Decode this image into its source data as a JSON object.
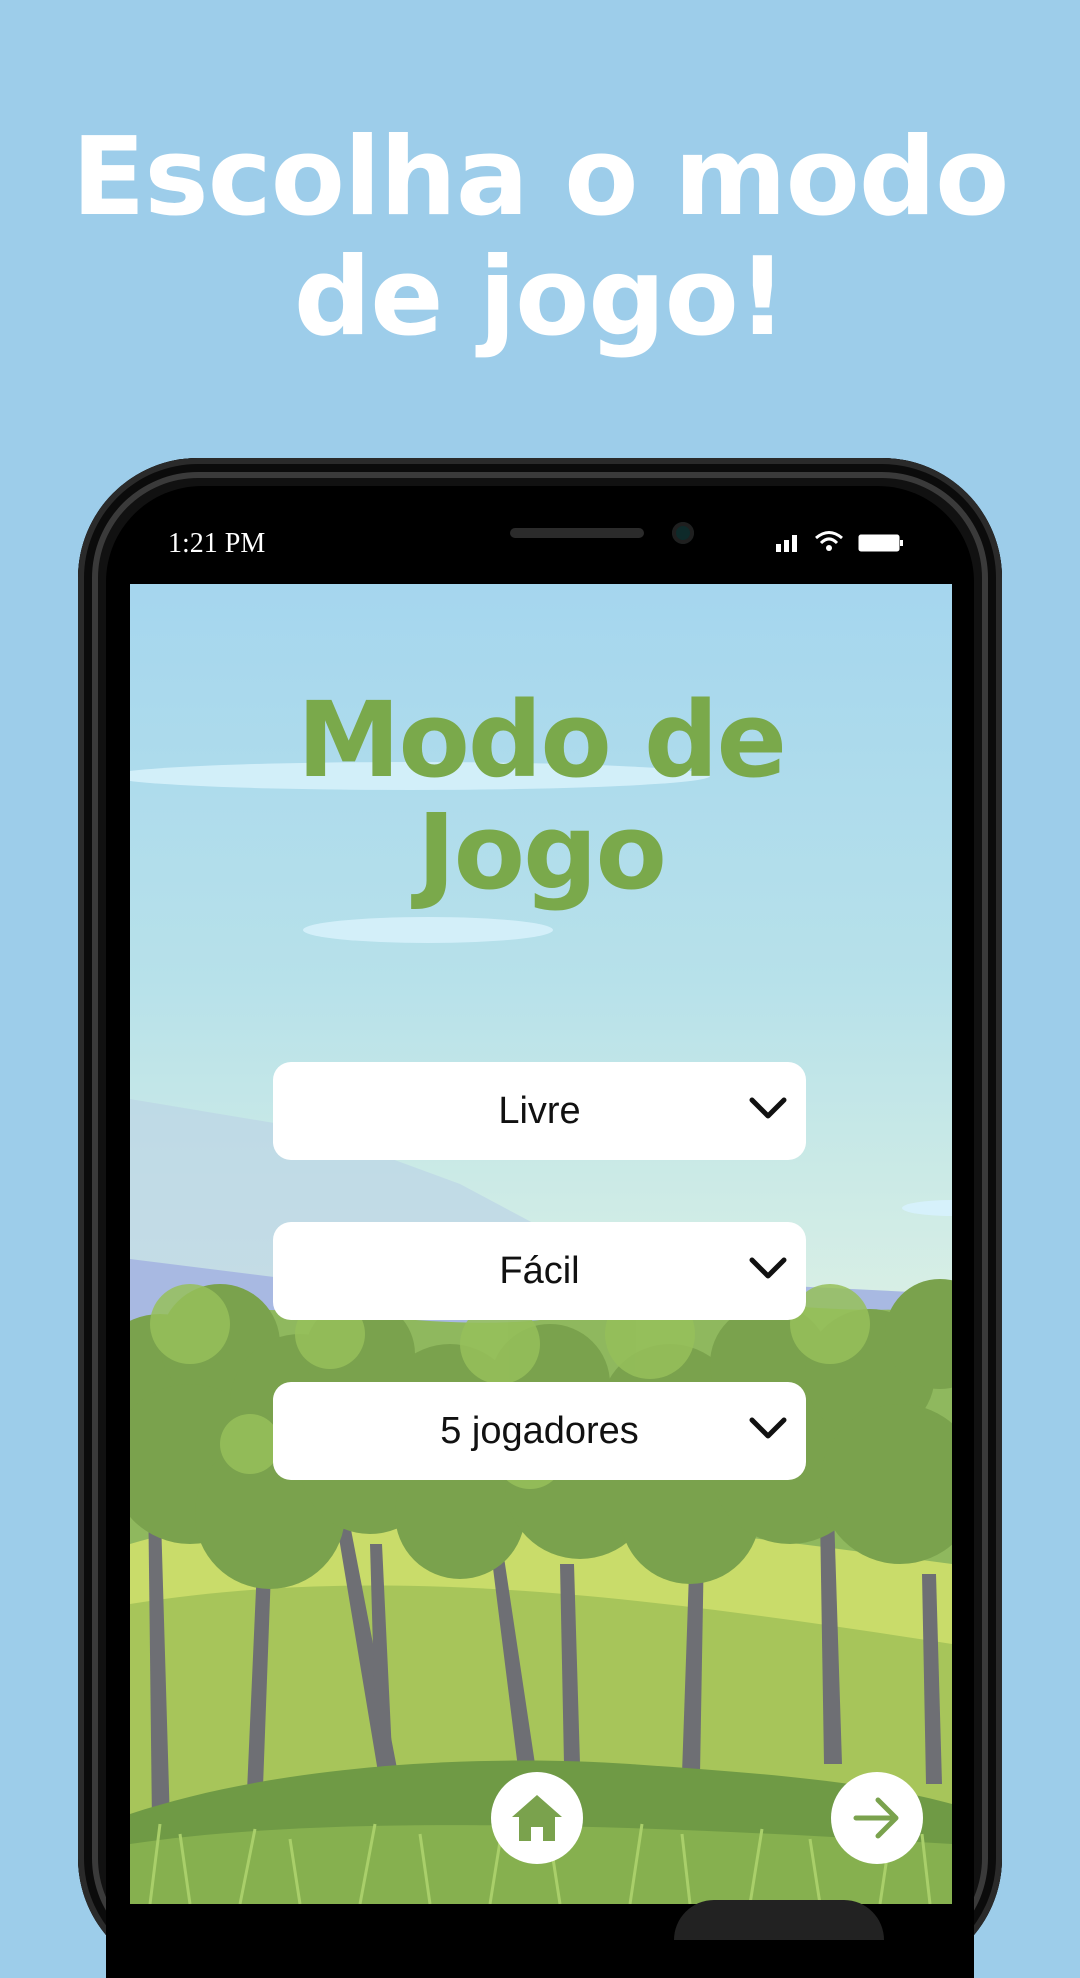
{
  "promo": {
    "title_line1": "Escolha o modo",
    "title_line2": "de jogo!"
  },
  "status_bar": {
    "time": "1:21 PM",
    "icons": [
      "signal-icon",
      "wifi-icon",
      "battery-icon"
    ]
  },
  "app": {
    "title_line1": "Modo de",
    "title_line2": "Jogo",
    "dropdowns": [
      {
        "name": "mode-select",
        "value": "Livre"
      },
      {
        "name": "difficulty-select",
        "value": "Fácil"
      },
      {
        "name": "players-select",
        "value": "5 jogadores"
      }
    ],
    "nav": {
      "home_icon": "home-icon",
      "next_icon": "arrow-right-icon"
    }
  },
  "colors": {
    "background": "#9dcdea",
    "title_green": "#7aa94b",
    "phone_body": "#111111"
  }
}
